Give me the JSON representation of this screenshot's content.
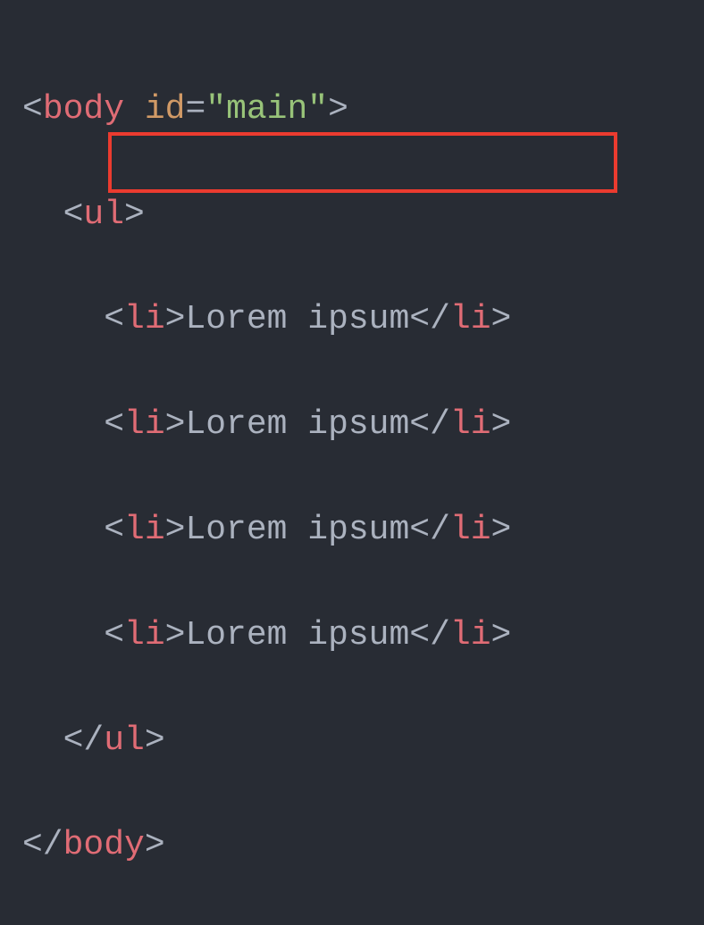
{
  "code": {
    "line1": {
      "open_angle": "<",
      "tag": "body",
      "space": " ",
      "attr": "id",
      "eq": "=",
      "quote1": "\"",
      "value": "main",
      "quote2": "\"",
      "close_angle": ">"
    },
    "line2": {
      "indent": "  ",
      "open_angle": "<",
      "tag": "ul",
      "close_angle": ">"
    },
    "line3": {
      "indent": "    ",
      "open_angle": "<",
      "tag": "li",
      "close_angle1": ">",
      "text": "Lorem ipsum",
      "open_angle2": "</",
      "tag2": "li",
      "close_angle2": ">"
    },
    "line4": {
      "indent": "    ",
      "open_angle": "<",
      "tag": "li",
      "close_angle1": ">",
      "text": "Lorem ipsum",
      "open_angle2": "</",
      "tag2": "li",
      "close_angle2": ">"
    },
    "line5": {
      "indent": "    ",
      "open_angle": "<",
      "tag": "li",
      "close_angle1": ">",
      "text": "Lorem ipsum",
      "open_angle2": "</",
      "tag2": "li",
      "close_angle2": ">"
    },
    "line6": {
      "indent": "    ",
      "open_angle": "<",
      "tag": "li",
      "close_angle1": ">",
      "text": "Lorem ipsum",
      "open_angle2": "</",
      "tag2": "li",
      "close_angle2": ">"
    },
    "line7": {
      "indent": "  ",
      "open_angle": "</",
      "tag": "ul",
      "close_angle": ">"
    },
    "line8": {
      "open_angle": "</",
      "tag": "body",
      "close_angle": ">"
    }
  }
}
